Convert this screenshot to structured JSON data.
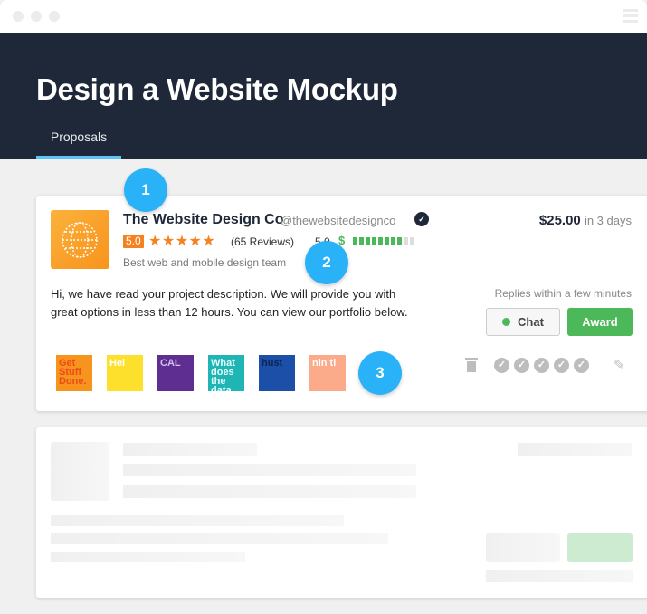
{
  "window": {
    "controls": [
      "close",
      "minimize",
      "maximize"
    ],
    "menu_icon": "hamburger-icon"
  },
  "header": {
    "title": "Design a Website Mockup",
    "tabs": [
      {
        "label": "Proposals",
        "active": true
      }
    ]
  },
  "proposal": {
    "freelancer_name": "The Website Design Co",
    "handle": "@thewebsitedesignco",
    "verified_icon": "verified-badge-icon",
    "rating": "5.0",
    "stars": "★★★★★",
    "stars_count": 5,
    "reviews": "(65 Reviews)",
    "earnings_score": "5.0",
    "earnings_symbol": "$",
    "earnings_level": {
      "filled": 8,
      "total": 10
    },
    "tagline": "Best web and mobile design team",
    "price": "$25.00",
    "delivery": "in 3 days",
    "description": "Hi, we have read your project description. We will provide you with great options in less than 12 hours. You can view our portfolio below.",
    "replies": "Replies within a few minutes",
    "chat_label": "Chat",
    "award_label": "Award",
    "portfolio": [
      {
        "text": "Get Stuff Done.",
        "bg": "#f7941d",
        "fg": "#ee4a1a"
      },
      {
        "text": "Hel",
        "bg": "#fde02c",
        "fg": "#ffffff"
      },
      {
        "text": "CAL",
        "bg": "#5e2e91",
        "fg": "#d6c2f0"
      },
      {
        "text": "What does the data say",
        "bg": "#1fb5b5",
        "fg": "#e6ffff"
      },
      {
        "text": "hust",
        "bg": "#1c4fa8",
        "fg": "#0e2350"
      },
      {
        "text": "nin ti",
        "bg": "#fbab8a",
        "fg": "#ffffff"
      }
    ],
    "action_icons": [
      "trash-icon",
      "check-icon",
      "check-icon",
      "check-icon",
      "check-icon",
      "check-icon",
      "pencil-icon"
    ]
  },
  "markers": [
    "1",
    "2",
    "3"
  ],
  "colors": {
    "header_bg": "#1f2838",
    "tab_underline": "#5cc4f6",
    "rating_orange": "#f58220",
    "green": "#4cb85a",
    "marker_blue": "#29b2f8"
  }
}
